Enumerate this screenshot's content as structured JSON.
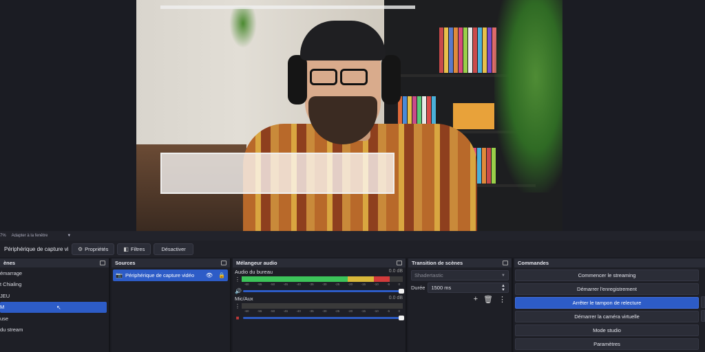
{
  "preview": {
    "zoom_label": "7%",
    "zoom_mode": "Adapter à la fenêtre"
  },
  "toolbar": {
    "source_name": "Périphérique de capture vi",
    "properties_label": "Propriétés",
    "filters_label": "Filtres",
    "disable_label": "Désactiver"
  },
  "scenes": {
    "title": "ènes",
    "items": [
      {
        "label": "émarrage"
      },
      {
        "label": "t Chialing"
      },
      {
        "label": "JEU"
      },
      {
        "label": "M"
      },
      {
        "label": "use"
      },
      {
        "label": " du stream"
      }
    ],
    "selected_index": 3
  },
  "sources": {
    "title": "Sources",
    "items": [
      {
        "label": "Périphérique de capture vidéo"
      }
    ]
  },
  "mixer": {
    "title": "Mélangeur audio",
    "channels": [
      {
        "name": "Audio du bureau",
        "db": "0.0 dB",
        "muted": false,
        "level": 0.92
      },
      {
        "name": "Mic/Aux",
        "db": "0.0 dB",
        "muted": true,
        "level": 0.0
      }
    ],
    "ticks": [
      "-60",
      "-55",
      "-50",
      "-45",
      "-40",
      "-35",
      "-30",
      "-25",
      "-20",
      "-15",
      "-10",
      "-5",
      "0"
    ]
  },
  "transitions": {
    "title": "Transition de scènes",
    "selected": "Shadertastic",
    "duration_label": "Durée",
    "duration_value": "1500 ms"
  },
  "controls": {
    "title": "Commandes",
    "buttons": [
      {
        "label": "Commencer le streaming",
        "active": false
      },
      {
        "label": "Démarrer l'enregistrement",
        "active": false
      },
      {
        "label": "Arrêter le tampon de relecture",
        "active": true
      },
      {
        "label": "Démarrer la caméra virtuelle",
        "active": false
      },
      {
        "label": "Mode studio",
        "active": false
      },
      {
        "label": "Paramètres",
        "active": false
      }
    ]
  },
  "colors": {
    "accent": "#2d5cc7",
    "meter_green": "#3cc45a",
    "meter_yellow": "#d9b83a",
    "meter_red": "#d23b3b",
    "mute_red": "#c23a3a"
  },
  "icons": {
    "properties": "gear-icon",
    "filters": "filter-icon",
    "visibility": "eye-icon",
    "lock": "lock-icon",
    "volume": "speaker-icon",
    "add": "plus-icon",
    "remove": "trash-icon",
    "menu": "kebab-menu-icon"
  }
}
